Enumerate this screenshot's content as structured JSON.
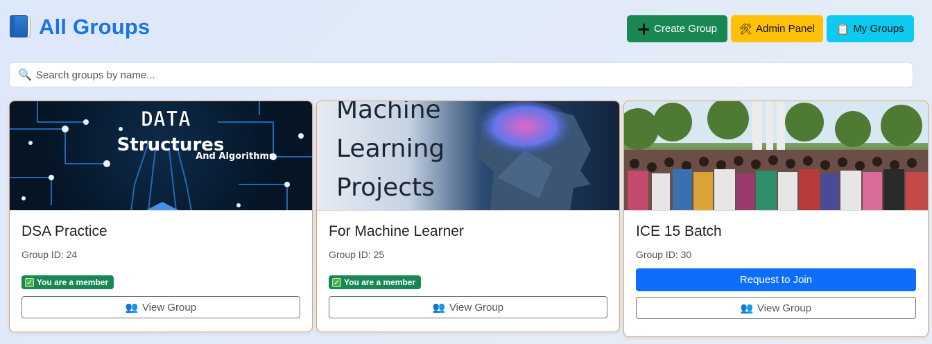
{
  "header": {
    "title": "All Groups",
    "buttons": {
      "create": "Create Group",
      "admin": "Admin Panel",
      "my_groups": "My Groups"
    }
  },
  "search": {
    "placeholder": "Search groups by name..."
  },
  "cards": [
    {
      "image_text": [
        "DATA",
        "Structures",
        "And Algorithms"
      ],
      "title": "DSA Practice",
      "group_id": "Group ID: 24",
      "badge": "You are a member",
      "view_label": "View Group"
    },
    {
      "image_text": [
        "Machine",
        "Learning",
        "Projects"
      ],
      "title": "For Machine Learner",
      "group_id": "Group ID: 25",
      "badge": "You are a member",
      "view_label": "View Group"
    },
    {
      "title": "ICE 15 Batch",
      "group_id": "Group ID: 30",
      "join_label": "Request to Join",
      "view_label": "View Group"
    }
  ],
  "colors": {
    "accent": "#1a73e8",
    "create": "#198754",
    "admin": "#ffc107",
    "my_groups": "#0dcaf0",
    "join": "#0d6efd",
    "card_border": "#e5a367"
  }
}
